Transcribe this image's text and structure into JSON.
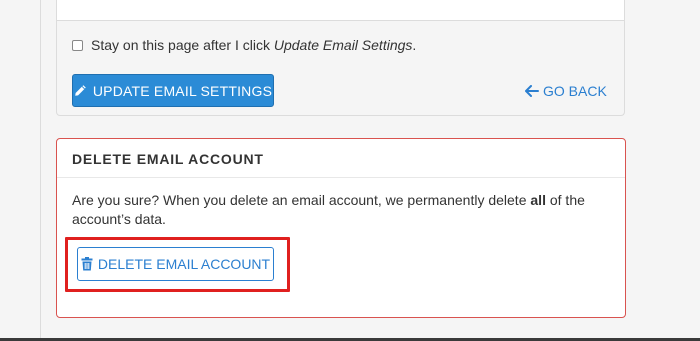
{
  "settings": {
    "stay_label_prefix": "Stay on this page after I click ",
    "stay_label_emphasis": "Update Email Settings",
    "stay_label_suffix": ".",
    "stay_checked": false,
    "update_button_label": "UPDATE EMAIL SETTINGS",
    "update_icon": "pencil-icon",
    "go_back_label": "GO BACK",
    "go_back_icon": "arrow-left-icon"
  },
  "delete_section": {
    "title": "DELETE EMAIL ACCOUNT",
    "message_prefix": "Are you sure? When you delete an email account, we permanently delete ",
    "message_bold": "all",
    "message_suffix": " of the account’s data.",
    "button_label": "DELETE EMAIL ACCOUNT",
    "button_icon": "trash-icon",
    "highlight_color": "#e0201f"
  },
  "colors": {
    "primary": "#2b8bd6",
    "link": "#2b7fd0",
    "danger_border": "#d9534f"
  }
}
